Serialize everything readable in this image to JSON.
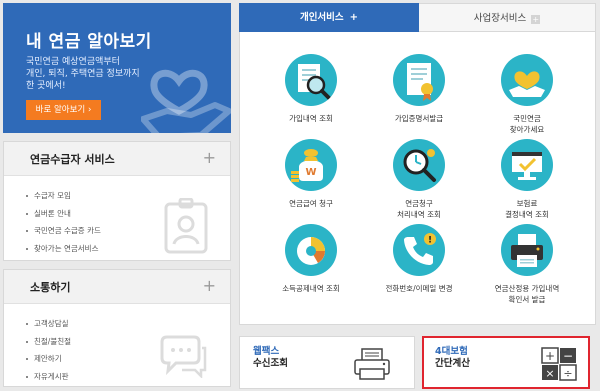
{
  "banner": {
    "title": "내 연금 알아보기",
    "desc_line1": "국민연금 예상연금액부터",
    "desc_line2": "개인, 퇴직, 주택연금 정보까지",
    "desc_line3": "한 곳에서!",
    "button": "바로 알아보기 ›"
  },
  "recipient_panel": {
    "title": "연금수급자 서비스",
    "plus": "+",
    "items": [
      "수급자 모임",
      "실버론 안내",
      "국민연금 수급증 카드",
      "찾아가는 연금서비스"
    ]
  },
  "comm_panel": {
    "title": "소통하기",
    "plus": "+",
    "items": [
      "고객상담실",
      "친절/불친절",
      "제안하기",
      "자유게시판"
    ]
  },
  "tabs": {
    "personal": "개인서비스",
    "personal_mark": "+",
    "business": "사업장서비스",
    "business_mark": "+"
  },
  "services": [
    {
      "line1": "가입내역 조회",
      "line2": "",
      "icon": "magnifier-document-icon"
    },
    {
      "line1": "가입증명서발급",
      "line2": "",
      "icon": "certificate-icon"
    },
    {
      "line1": "국민연금",
      "line2": "찾아가세요",
      "icon": "heart-hands-icon"
    },
    {
      "line1": "연금급여 청구",
      "line2": "",
      "icon": "money-bag-icon"
    },
    {
      "line1": "연금청구",
      "line2": "처리내역 조회",
      "icon": "search-clock-icon"
    },
    {
      "line1": "보험료",
      "line2": "결정내역 조회",
      "icon": "monitor-check-icon"
    },
    {
      "line1": "소득공제내역 조회",
      "line2": "",
      "icon": "pie-chart-icon"
    },
    {
      "line1": "전화번호/이메일 변경",
      "line2": "",
      "icon": "phone-icon"
    },
    {
      "line1": "연금산정용 가입내역",
      "line2": "확인서 발급",
      "icon": "printer-icon"
    }
  ],
  "cards": {
    "fax_line1": "웹팩스",
    "fax_line2": "수신조회",
    "calc_line1": "4대보험",
    "calc_line2": "간단계산"
  },
  "colors": {
    "brand_blue": "#2f6ab8",
    "accent_orange": "#f47b20",
    "icon_teal": "#2bb4c7",
    "highlight_red": "#e0252f"
  }
}
